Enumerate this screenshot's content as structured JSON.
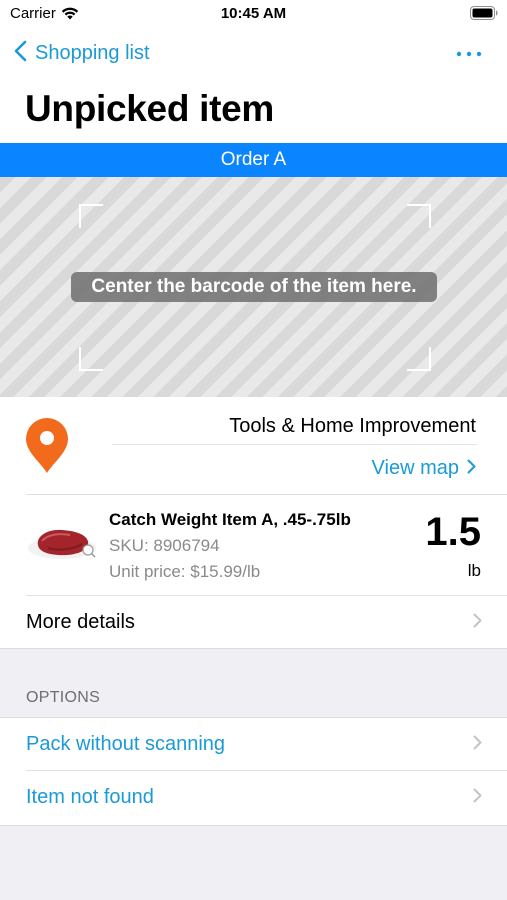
{
  "status_bar": {
    "carrier": "Carrier",
    "time": "10:45 AM"
  },
  "nav": {
    "back_label": "Shopping list",
    "title": "Unpicked item",
    "more_icon": "ellipsis-icon"
  },
  "order_banner": "Order A",
  "scanner": {
    "hint": "Center the barcode of the item here."
  },
  "location": {
    "department": "Tools & Home Improvement",
    "view_map_label": "View map"
  },
  "item": {
    "name": "Catch Weight Item A, .45-.75lb",
    "sku": "SKU: 8906794",
    "unit_price": "Unit price: $15.99/lb",
    "quantity": "1.5",
    "unit": "lb"
  },
  "more_details_label": "More details",
  "options": {
    "header": "OPTIONS",
    "items": [
      {
        "label": "Pack without scanning"
      },
      {
        "label": "Item not found"
      }
    ]
  },
  "colors": {
    "accent": "#1a9ad6",
    "banner": "#0a84ff",
    "pin": "#f26a1b"
  }
}
